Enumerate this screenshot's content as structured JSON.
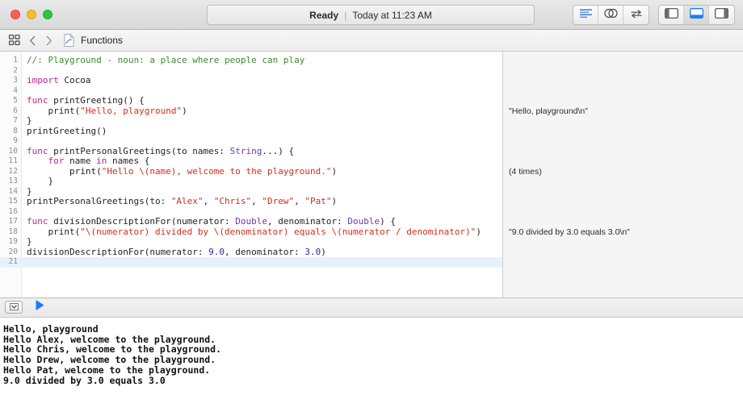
{
  "window": {
    "traffic_lights": [
      {
        "name": "close",
        "color": "#ff5f57"
      },
      {
        "name": "minimize",
        "color": "#febc2e"
      },
      {
        "name": "maximize",
        "color": "#28c840"
      }
    ]
  },
  "toolbar": {
    "status": {
      "state": "Ready",
      "separator": "|",
      "time": "Today at 11:23 AM"
    },
    "editor_modes": [
      {
        "name": "standard-editor",
        "icon": "lines-icon",
        "active": false
      },
      {
        "name": "assistant-editor",
        "icon": "venn-icon",
        "active": false
      },
      {
        "name": "version-editor",
        "icon": "arrows-icon",
        "active": false
      }
    ],
    "panel_toggles": [
      {
        "name": "navigator-toggle",
        "icon": "left-panel-icon",
        "active": false
      },
      {
        "name": "debug-area-toggle",
        "icon": "bottom-panel-icon",
        "active": true
      },
      {
        "name": "utilities-toggle",
        "icon": "right-panel-icon",
        "active": false
      }
    ],
    "accent": "#1a7df0"
  },
  "jumpbar": {
    "grid_icon": "related-items-icon",
    "back_icon": "chevron-left-icon",
    "forward_icon": "chevron-right-icon",
    "file_icon": "playground-file-icon",
    "label": "Functions"
  },
  "editor": {
    "current_line": 21,
    "lines": [
      {
        "n": 1,
        "tokens": [
          {
            "t": "comment",
            "v": "//: Playground - noun: a place where people can play"
          }
        ]
      },
      {
        "n": 2,
        "tokens": []
      },
      {
        "n": 3,
        "tokens": [
          {
            "t": "kw",
            "v": "import"
          },
          {
            "t": "plain",
            "v": " Cocoa"
          }
        ]
      },
      {
        "n": 4,
        "tokens": []
      },
      {
        "n": 5,
        "tokens": [
          {
            "t": "kw",
            "v": "func"
          },
          {
            "t": "plain",
            "v": " printGreeting() {"
          }
        ]
      },
      {
        "n": 6,
        "tokens": [
          {
            "t": "plain",
            "v": "    print("
          },
          {
            "t": "str",
            "v": "\"Hello, playground\""
          },
          {
            "t": "plain",
            "v": ")"
          }
        ]
      },
      {
        "n": 7,
        "tokens": [
          {
            "t": "plain",
            "v": "}"
          }
        ]
      },
      {
        "n": 8,
        "tokens": [
          {
            "t": "plain",
            "v": "printGreeting()"
          }
        ]
      },
      {
        "n": 9,
        "tokens": []
      },
      {
        "n": 10,
        "tokens": [
          {
            "t": "kw",
            "v": "func"
          },
          {
            "t": "plain",
            "v": " printPersonalGreetings(to names: "
          },
          {
            "t": "type",
            "v": "String"
          },
          {
            "t": "plain",
            "v": "...) {"
          }
        ]
      },
      {
        "n": 11,
        "tokens": [
          {
            "t": "plain",
            "v": "    "
          },
          {
            "t": "kw",
            "v": "for"
          },
          {
            "t": "plain",
            "v": " name "
          },
          {
            "t": "kw",
            "v": "in"
          },
          {
            "t": "plain",
            "v": " names {"
          }
        ]
      },
      {
        "n": 12,
        "tokens": [
          {
            "t": "plain",
            "v": "        print("
          },
          {
            "t": "str",
            "v": "\"Hello \\(name), welcome to the playground.\""
          },
          {
            "t": "plain",
            "v": ")"
          }
        ]
      },
      {
        "n": 13,
        "tokens": [
          {
            "t": "plain",
            "v": "    }"
          }
        ]
      },
      {
        "n": 14,
        "tokens": [
          {
            "t": "plain",
            "v": "}"
          }
        ]
      },
      {
        "n": 15,
        "tokens": [
          {
            "t": "plain",
            "v": "printPersonalGreetings(to: "
          },
          {
            "t": "str",
            "v": "\"Alex\""
          },
          {
            "t": "plain",
            "v": ", "
          },
          {
            "t": "str",
            "v": "\"Chris\""
          },
          {
            "t": "plain",
            "v": ", "
          },
          {
            "t": "str",
            "v": "\"Drew\""
          },
          {
            "t": "plain",
            "v": ", "
          },
          {
            "t": "str",
            "v": "\"Pat\""
          },
          {
            "t": "plain",
            "v": ")"
          }
        ]
      },
      {
        "n": 16,
        "tokens": []
      },
      {
        "n": 17,
        "tokens": [
          {
            "t": "kw",
            "v": "func"
          },
          {
            "t": "plain",
            "v": " divisionDescriptionFor(numerator: "
          },
          {
            "t": "type",
            "v": "Double"
          },
          {
            "t": "plain",
            "v": ", denominator: "
          },
          {
            "t": "type",
            "v": "Double"
          },
          {
            "t": "plain",
            "v": ") {"
          }
        ]
      },
      {
        "n": 18,
        "tokens": [
          {
            "t": "plain",
            "v": "    print("
          },
          {
            "t": "str",
            "v": "\"\\(numerator) divided by \\(denominator) equals \\(numerator / denominator)\""
          },
          {
            "t": "plain",
            "v": ")"
          }
        ]
      },
      {
        "n": 19,
        "tokens": [
          {
            "t": "plain",
            "v": "}"
          }
        ]
      },
      {
        "n": 20,
        "tokens": [
          {
            "t": "plain",
            "v": "divisionDescriptionFor(numerator: "
          },
          {
            "t": "num",
            "v": "9.0"
          },
          {
            "t": "plain",
            "v": ", denominator: "
          },
          {
            "t": "num",
            "v": "3.0"
          },
          {
            "t": "plain",
            "v": ")"
          }
        ]
      },
      {
        "n": 21,
        "tokens": []
      }
    ]
  },
  "results": [
    {
      "line": 6,
      "text": "\"Hello, playground\\n\""
    },
    {
      "line": 12,
      "text": "(4 times)"
    },
    {
      "line": 18,
      "text": "\"9.0 divided by 3.0 equals 3.0\\n\""
    }
  ],
  "debug_bar": {
    "hide_console_icon": "chevron-down-box-icon",
    "execute_icon": "play-triangle-icon",
    "execute_color": "#1a7df0"
  },
  "console": {
    "lines": [
      "Hello, playground",
      "Hello Alex, welcome to the playground.",
      "Hello Chris, welcome to the playground.",
      "Hello Drew, welcome to the playground.",
      "Hello Pat, welcome to the playground.",
      "9.0 divided by 3.0 equals 3.0"
    ]
  }
}
